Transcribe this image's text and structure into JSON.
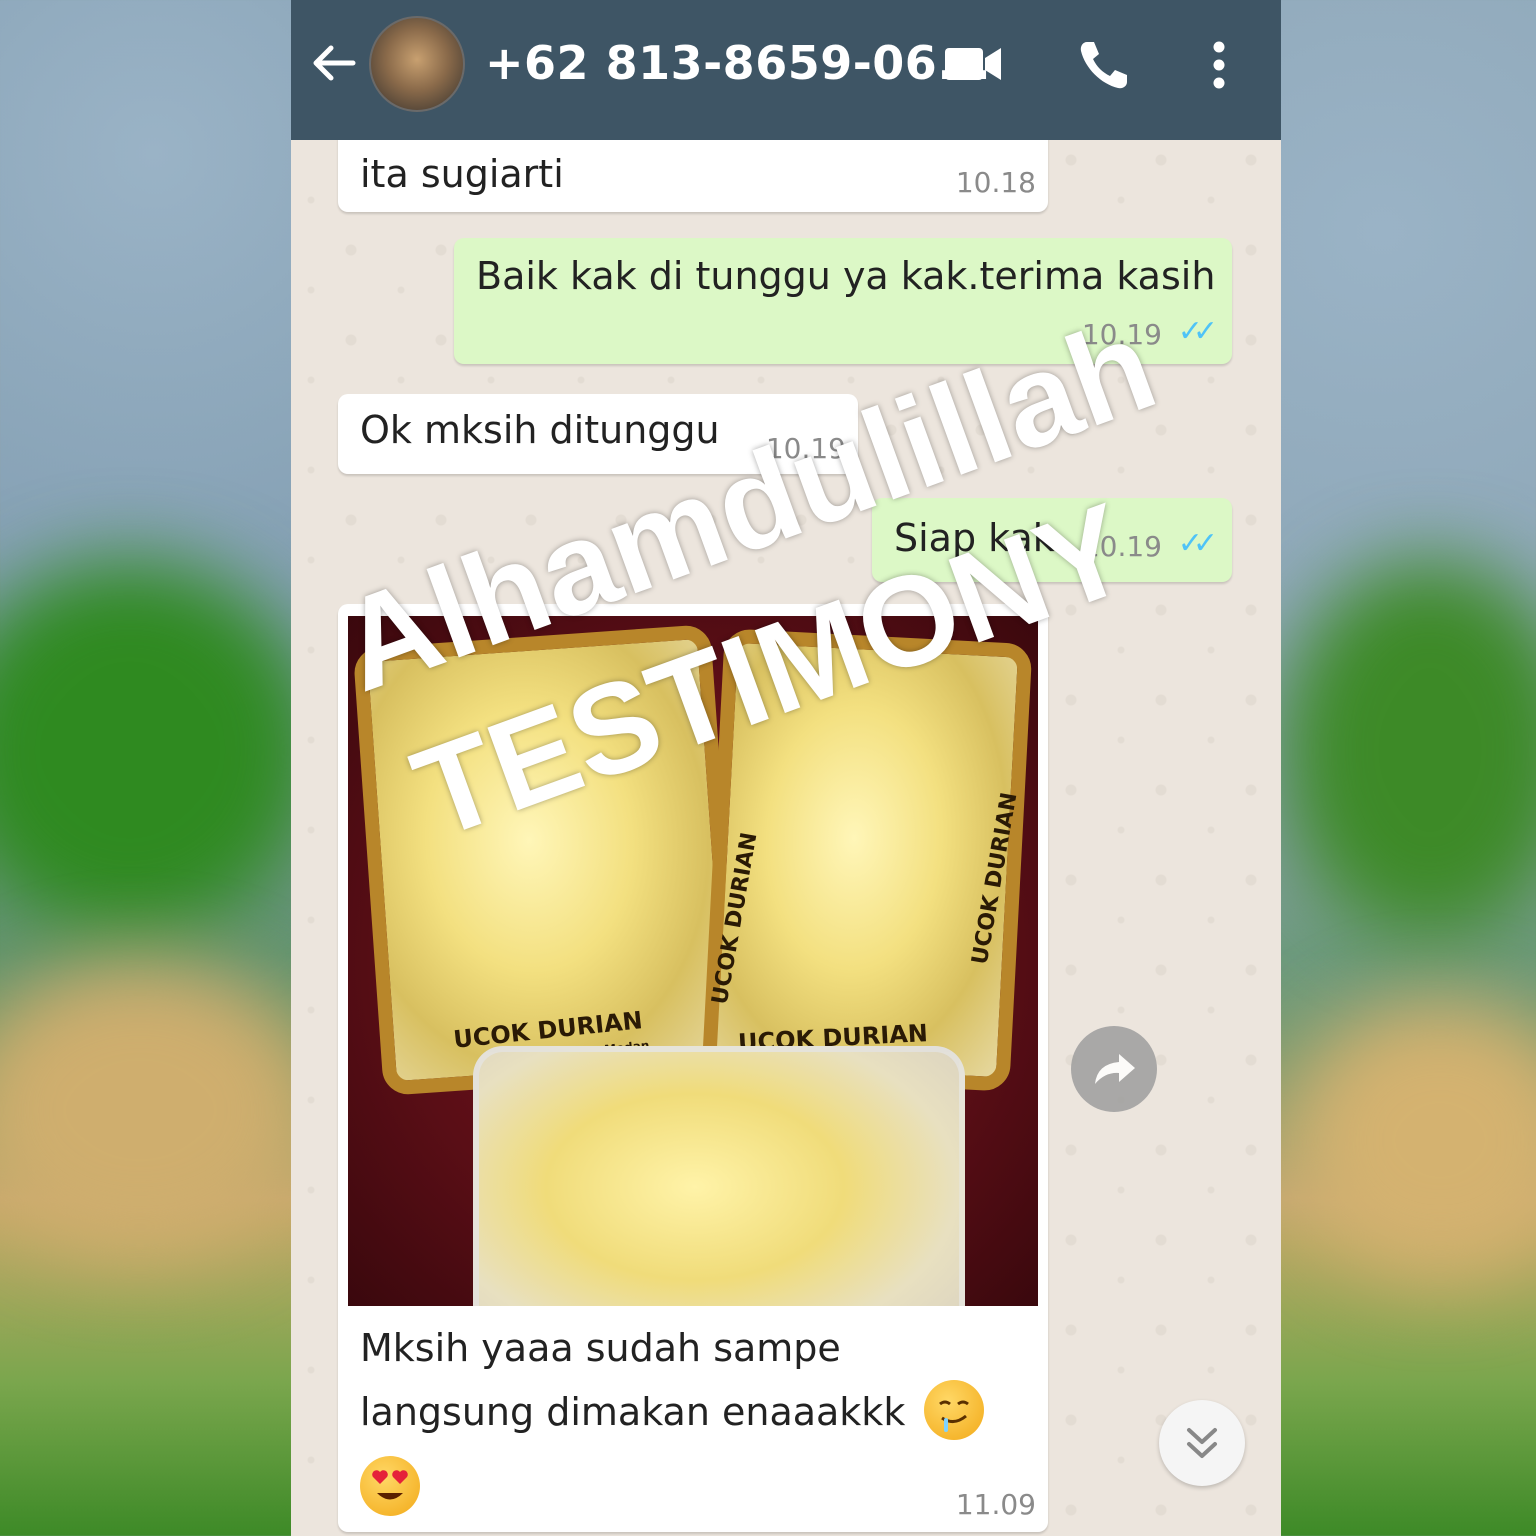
{
  "header": {
    "contact_title": "+62 813-8659-06...",
    "icons": [
      "back-arrow-icon",
      "contact-avatar",
      "video-call-icon",
      "phone-call-icon",
      "more-options-icon"
    ]
  },
  "messages": [
    {
      "direction": "incoming",
      "text": "ita sugiarti",
      "time": "10.18"
    },
    {
      "direction": "outgoing",
      "text": "Baik kak di tunggu ya kak.terima kasih",
      "time": "10.19",
      "status": "read"
    },
    {
      "direction": "incoming",
      "text": "Ok mksih ditunggu",
      "time": "10.19"
    },
    {
      "direction": "outgoing",
      "text": "Siap kak",
      "time": "10.19",
      "status": "read"
    },
    {
      "direction": "incoming",
      "photo_labels": [
        "UCOK DURIAN",
        "Oleh-oleh Khas Medan"
      ],
      "caption_line1": "Mksih yaaa sudah sampe",
      "caption_line2": "langsung dimakan enaaakkk",
      "emojis": [
        "drooling-face-emoji",
        "heart-eyes-emoji"
      ],
      "time": "11.09"
    }
  ],
  "overlay": {
    "line1": "Alhamdulillah",
    "line2": "TESTIMONY"
  },
  "colors": {
    "header": "#3e5565",
    "chat_bg": "#ece5dd",
    "outgoing_bubble": "#dcf8c6",
    "incoming_bubble": "#ffffff",
    "read_ticks": "#4fc3f7"
  }
}
